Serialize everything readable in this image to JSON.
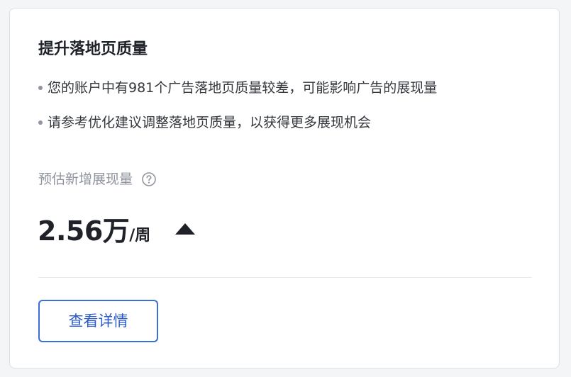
{
  "card": {
    "title": "提升落地页质量",
    "bullets": [
      {
        "text": "您的账户中有981个广告落地页质量较差，可能影响广告的展现量"
      },
      {
        "text": "请参考优化建议调整落地页质量，以获得更多展现机会"
      }
    ],
    "metric": {
      "label": "预估新增展现量",
      "help_icon": "question-circle-icon",
      "value": "2.56万",
      "unit": "/周",
      "trend_icon": "triangle-up-icon"
    },
    "button": {
      "label": "查看详情"
    }
  },
  "colors": {
    "title": "#1f2329",
    "body_text": "#33373d",
    "muted_text": "#8f959e",
    "accent": "#3a6fd6",
    "border": "#dcdfe6"
  }
}
